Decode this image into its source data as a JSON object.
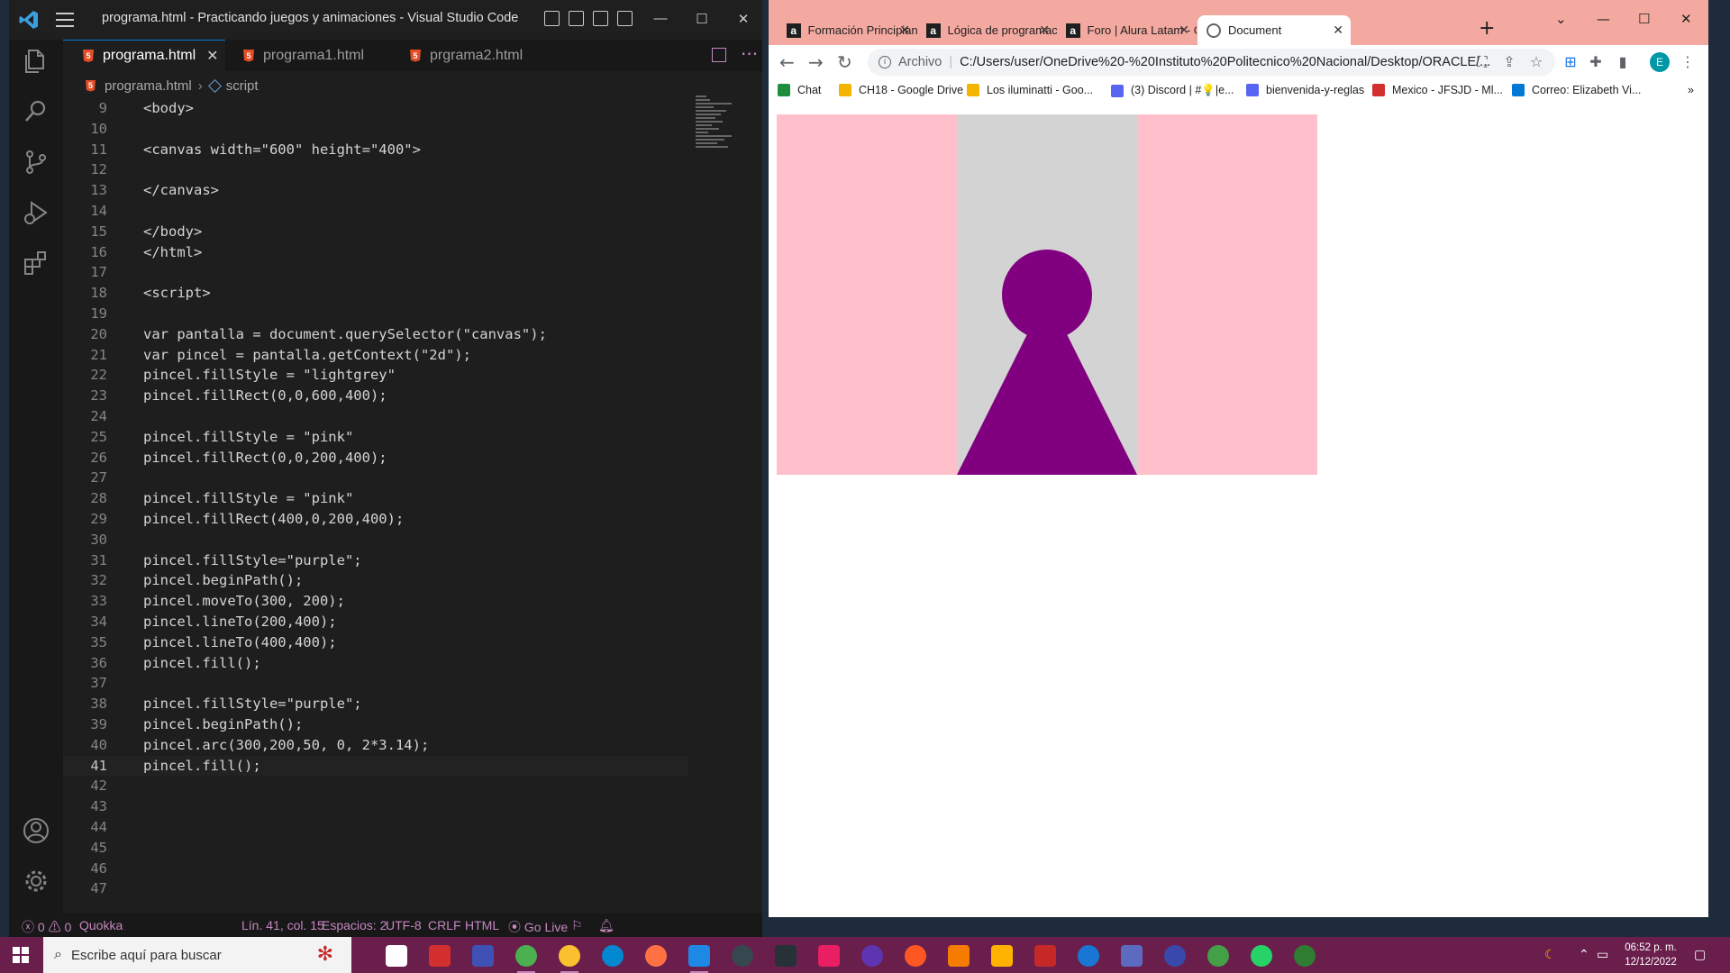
{
  "vscode": {
    "title": "programa.html - Practicando juegos y animaciones - Visual Studio Code",
    "tabs": [
      {
        "label": "programa.html",
        "active": true,
        "close": "✕"
      },
      {
        "label": "programa1.html",
        "active": false
      },
      {
        "label": "prgrama2.html",
        "active": false
      }
    ],
    "breadcrumb": {
      "file": "programa.html",
      "sep": "›",
      "symbol": "script"
    },
    "code_lines": [
      {
        "n": "9",
        "text": "<body>"
      },
      {
        "n": "10",
        "text": ""
      },
      {
        "n": "11",
        "text": "<canvas width=\"600\" height=\"400\">"
      },
      {
        "n": "12",
        "text": ""
      },
      {
        "n": "13",
        "text": "</canvas>"
      },
      {
        "n": "14",
        "text": ""
      },
      {
        "n": "15",
        "text": "</body>"
      },
      {
        "n": "16",
        "text": "</html>"
      },
      {
        "n": "17",
        "text": ""
      },
      {
        "n": "18",
        "text": "<script>"
      },
      {
        "n": "19",
        "text": ""
      },
      {
        "n": "20",
        "text": "var pantalla = document.querySelector(\"canvas\");"
      },
      {
        "n": "21",
        "text": "var pincel = pantalla.getContext(\"2d\");"
      },
      {
        "n": "22",
        "text": "pincel.fillStyle = \"lightgrey\""
      },
      {
        "n": "23",
        "text": "pincel.fillRect(0,0,600,400);"
      },
      {
        "n": "24",
        "text": ""
      },
      {
        "n": "25",
        "text": "pincel.fillStyle = \"pink\""
      },
      {
        "n": "26",
        "text": "pincel.fillRect(0,0,200,400);"
      },
      {
        "n": "27",
        "text": ""
      },
      {
        "n": "28",
        "text": "pincel.fillStyle = \"pink\""
      },
      {
        "n": "29",
        "text": "pincel.fillRect(400,0,200,400);"
      },
      {
        "n": "30",
        "text": ""
      },
      {
        "n": "31",
        "text": "pincel.fillStyle=\"purple\";"
      },
      {
        "n": "32",
        "text": "pincel.beginPath();"
      },
      {
        "n": "33",
        "text": "pincel.moveTo(300, 200);"
      },
      {
        "n": "34",
        "text": "pincel.lineTo(200,400);"
      },
      {
        "n": "35",
        "text": "pincel.lineTo(400,400);"
      },
      {
        "n": "36",
        "text": "pincel.fill();"
      },
      {
        "n": "37",
        "text": ""
      },
      {
        "n": "38",
        "text": "pincel.fillStyle=\"purple\";"
      },
      {
        "n": "39",
        "text": "pincel.beginPath();"
      },
      {
        "n": "40",
        "text": "pincel.arc(300,200,50, 0, 2*3.14);"
      },
      {
        "n": "41",
        "text": "pincel.fill();"
      },
      {
        "n": "42",
        "text": ""
      },
      {
        "n": "43",
        "text": ""
      },
      {
        "n": "44",
        "text": ""
      },
      {
        "n": "45",
        "text": ""
      },
      {
        "n": "46",
        "text": ""
      },
      {
        "n": "47",
        "text": ""
      }
    ],
    "current_line": "41",
    "status": {
      "errors": "0",
      "warnings": "0",
      "quokka": "Quokka",
      "position": "Lín. 41, col. 15",
      "spaces": "Espacios: 2",
      "encoding": "UTF-8",
      "eol": "CRLF",
      "language": "HTML",
      "golive": "Go Live"
    }
  },
  "chrome": {
    "tabs": [
      {
        "label": "Formación Principiante",
        "icon": "a-icon"
      },
      {
        "label": "Lógica de programación",
        "icon": "a-icon"
      },
      {
        "label": "Foro | Alura Latam - Cu",
        "icon": "a-icon"
      },
      {
        "label": "Document",
        "icon": "globe-icon",
        "active": true
      }
    ],
    "address": {
      "prefix": "Archivo",
      "url": "C:/Users/user/OneDrive%20-%20Instituto%20Politecnico%20Nacional/Desktop/ORACLE/..."
    },
    "profile_initial": "E",
    "bookmarks": [
      {
        "label": "Chat",
        "color": "#1e8e3e"
      },
      {
        "label": "CH18 - Google Drive",
        "color": "#f4b400"
      },
      {
        "label": "Los iluminatti - Goo...",
        "color": "#f4b400"
      },
      {
        "label": "(3) Discord | #💡|e...",
        "color": "#5865f2"
      },
      {
        "label": "bienvenida-y-reglas",
        "color": "#5865f2"
      },
      {
        "label": "Mexico - JFSJD - Ml...",
        "color": "#d32f2f"
      },
      {
        "label": "Correo: Elizabeth Vi...",
        "color": "#0078d4"
      }
    ],
    "canvas_colors": {
      "background": "#d3d3d3",
      "sides": "#ffc0cb",
      "figure": "#800080"
    }
  },
  "taskbar": {
    "search_placeholder": "Escribe aquí para buscar",
    "time": "06:52 p. m.",
    "date": "12/12/2022"
  }
}
